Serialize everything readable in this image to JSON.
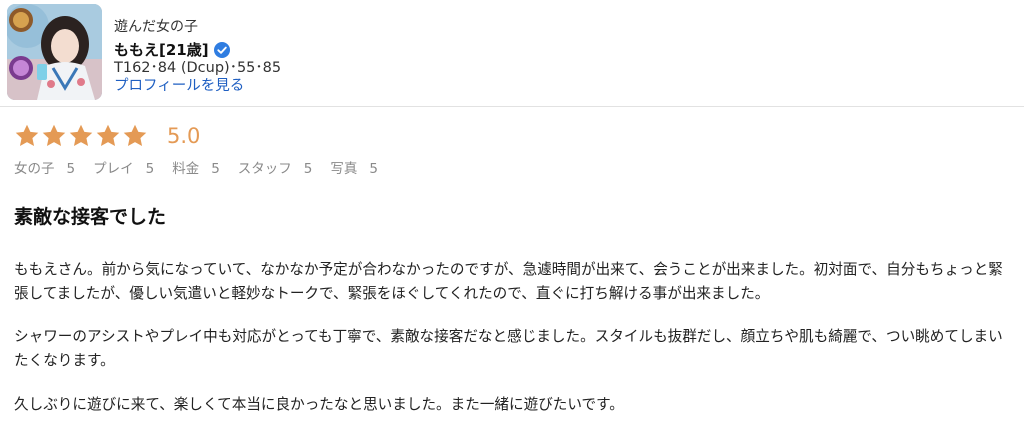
{
  "header": {
    "girl_label": "遊んだ女の子",
    "name": "ももえ[21歳]",
    "stats": "T162･84 (Dcup)･55･85",
    "profile_link": "プロフィールを見る",
    "verified_icon": "verified-check-icon",
    "verified_color": "#2f7de1",
    "link_color": "#1f5fc2"
  },
  "rating": {
    "stars": 5,
    "score": "5.0",
    "star_color": "#e49a55",
    "breakdown": [
      {
        "label": "女の子",
        "value": "5"
      },
      {
        "label": "プレイ",
        "value": "5"
      },
      {
        "label": "料金",
        "value": "5"
      },
      {
        "label": "スタッフ",
        "value": "5"
      },
      {
        "label": "写真",
        "value": "5"
      }
    ]
  },
  "review": {
    "title": "素敵な接客でした",
    "paragraphs": [
      "ももえさん。前から気になっていて、なかなか予定が合わなかったのですが、急遽時間が出来て、会うことが出来ました。初対面で、自分もちょっと緊張してましたが、優しい気遣いと軽妙なトークで、緊張をほぐしてくれたので、直ぐに打ち解ける事が出来ました。",
      "シャワーのアシストやプレイ中も対応がとっても丁寧で、素敵な接客だなと感じました。スタイルも抜群だし、顔立ちや肌も綺麗で、つい眺めてしまいたくなります。",
      "久しぶりに遊びに来て、楽しくて本当に良かったなと思いました。また一緒に遊びたいです。"
    ]
  }
}
